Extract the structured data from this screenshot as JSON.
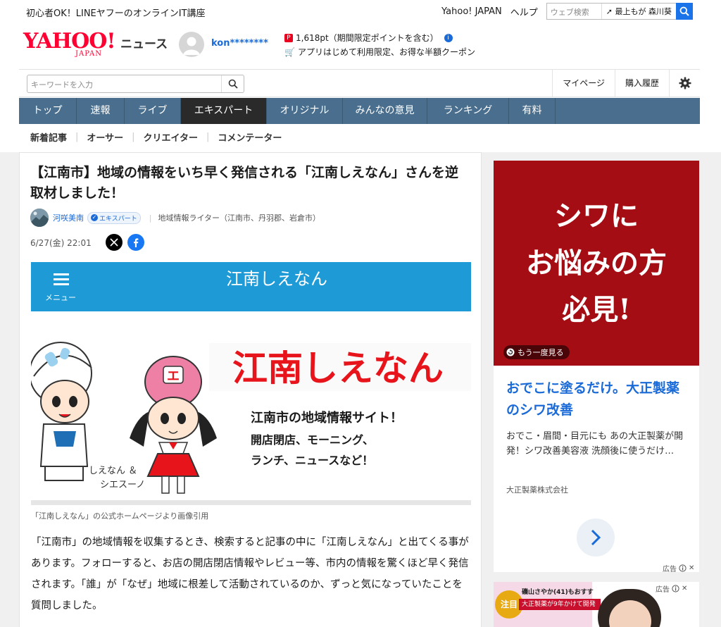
{
  "header": {
    "promo_text": "初心者OK！LINEヤフーのオンラインIT講座",
    "links": {
      "yahoo_japan": "Yahoo! JAPAN",
      "help": "ヘルプ"
    },
    "web_search": {
      "placeholder": "ウェブ検索",
      "trending": "最上もが 森川葵"
    },
    "logo": {
      "brand": "YAHOO!",
      "brand_sub": "JAPAN",
      "section": "ニュース"
    },
    "user": {
      "name": "kon********"
    },
    "points": {
      "text": "1,618pt（期間限定ポイントを含む）",
      "coupon": "アプリはじめて利用限定、お得な半額クーポン"
    }
  },
  "search": {
    "placeholder": "キーワードを入力",
    "my_page": "マイページ",
    "purchase_history": "購入履歴"
  },
  "nav": {
    "tabs": [
      {
        "label": "トップ",
        "active": false
      },
      {
        "label": "速報",
        "active": false
      },
      {
        "label": "ライブ",
        "active": false
      },
      {
        "label": "エキスパート",
        "active": true
      },
      {
        "label": "オリジナル",
        "active": false
      },
      {
        "label": "みんなの意見",
        "active": false
      },
      {
        "label": "ランキング",
        "active": false
      },
      {
        "label": "有料",
        "active": false
      }
    ],
    "subtabs": [
      "新着記事",
      "オーサー",
      "クリエイター",
      "コメンテーター"
    ]
  },
  "article": {
    "title": "【江南市】地域の情報をいち早く発信される「江南しえなん」さんを逆取材しました！",
    "author_name": "河咲美南",
    "author_badge": "エキスパート",
    "author_role": "地域情報ライター（江南市、丹羽郡、岩倉市）",
    "date": "6/27(金) 22:01",
    "image": {
      "bar_menu": "メニュー",
      "bar_title": "江南しえなん",
      "logo_text": "江南しえなん",
      "tagline1": "江南市の地域情報サイト！",
      "tagline2": "開店閉店、モーニング、",
      "tagline3": "ランチ、ニュースなど！",
      "mascots": "しえなん ＆",
      "mascots2": "シエスーノ",
      "mascot_cap_letter": "エ"
    },
    "caption": "「江南しえなん」の公式ホームページより画像引用",
    "body": "「江南市」の地域情報を収集するとき、検索すると記事の中に「江南しえなん」と出てくる事があります。フォローすると、お店の開店閉店情報やレビュー等、市内の情報を驚くほど早く発信されます。「誰」が「なぜ」地域に根差して活動されているのか、ずっと気になっていたことを質問しました。"
  },
  "ad": {
    "image_line1": "シワに",
    "image_line2": "お悩みの方",
    "image_line3": "必見!",
    "replay": "もう一度見る",
    "title": "おでこに塗るだけ。大正製薬のシワ改善",
    "description": "おでこ・眉間・目元にも あの大正製薬が開発！シワ改善美容液 洗顔後に使うだけ…",
    "company": "大正製薬株式会社",
    "ad_label": "広告",
    "ad2": {
      "badge": "注目",
      "headline": "磯山さやか(41)もおすすめ！",
      "subline": "大正製薬が9年かけて開発",
      "ad_label": "広告"
    }
  }
}
